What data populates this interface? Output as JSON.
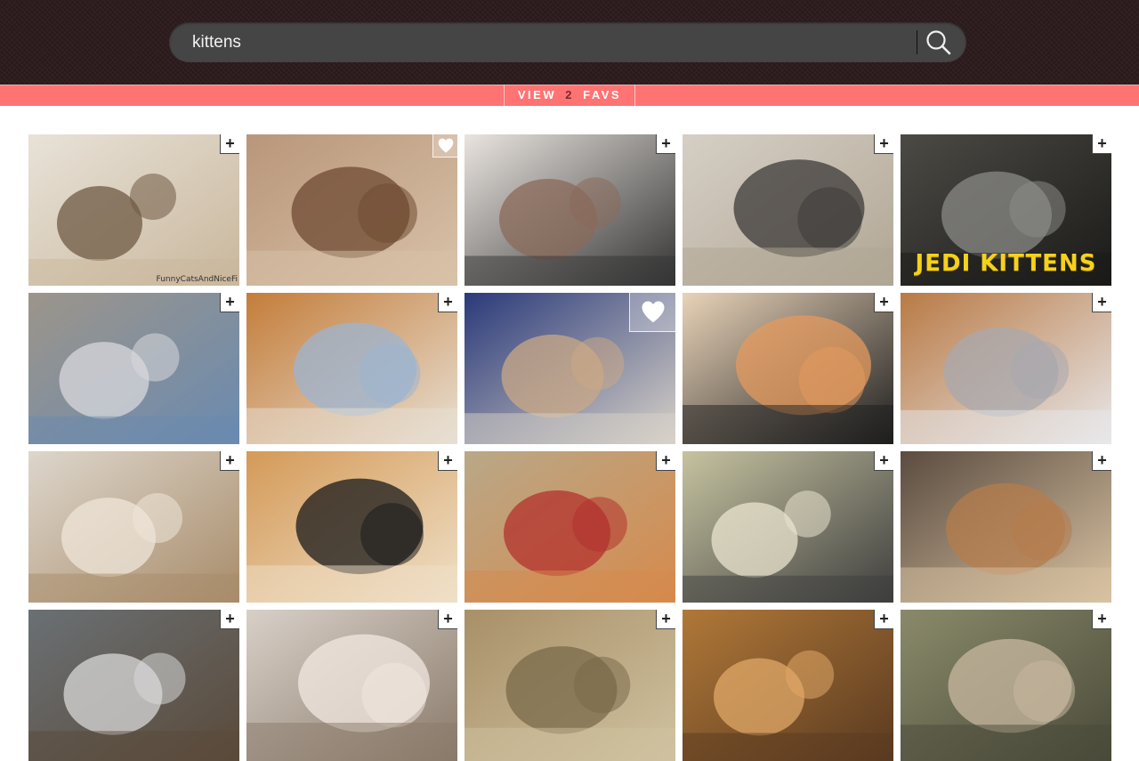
{
  "search": {
    "query": "kittens",
    "placeholder": ""
  },
  "favs_bar": {
    "prefix": "VIEW",
    "count": "2",
    "suffix": "FAVS"
  },
  "tiles": [
    {
      "favorited": false,
      "caption": "",
      "watermark": "FunnyCatsAndNiceFi"
    },
    {
      "favorited": true,
      "caption": "",
      "watermark": ""
    },
    {
      "favorited": false,
      "caption": "",
      "watermark": ""
    },
    {
      "favorited": false,
      "caption": "",
      "watermark": ""
    },
    {
      "favorited": false,
      "caption": "JEDI KITTENS",
      "watermark": ""
    },
    {
      "favorited": false,
      "caption": "",
      "watermark": ""
    },
    {
      "favorited": false,
      "caption": "",
      "watermark": ""
    },
    {
      "favorited": true,
      "caption": "",
      "watermark": ""
    },
    {
      "favorited": false,
      "caption": "",
      "watermark": ""
    },
    {
      "favorited": false,
      "caption": "",
      "watermark": ""
    },
    {
      "favorited": false,
      "caption": "",
      "watermark": ""
    },
    {
      "favorited": false,
      "caption": "",
      "watermark": ""
    },
    {
      "favorited": false,
      "caption": "",
      "watermark": ""
    },
    {
      "favorited": false,
      "caption": "",
      "watermark": ""
    },
    {
      "favorited": false,
      "caption": "",
      "watermark": ""
    },
    {
      "favorited": false,
      "caption": "",
      "watermark": ""
    },
    {
      "favorited": false,
      "caption": "",
      "watermark": ""
    },
    {
      "favorited": false,
      "caption": "",
      "watermark": ""
    },
    {
      "favorited": false,
      "caption": "",
      "watermark": ""
    },
    {
      "favorited": false,
      "caption": "",
      "watermark": ""
    }
  ],
  "add_button_label": "+",
  "colors": {
    "header_bg": "#2e1c1e",
    "favs_bar": "#ff7373",
    "search_bg": "#454545"
  }
}
